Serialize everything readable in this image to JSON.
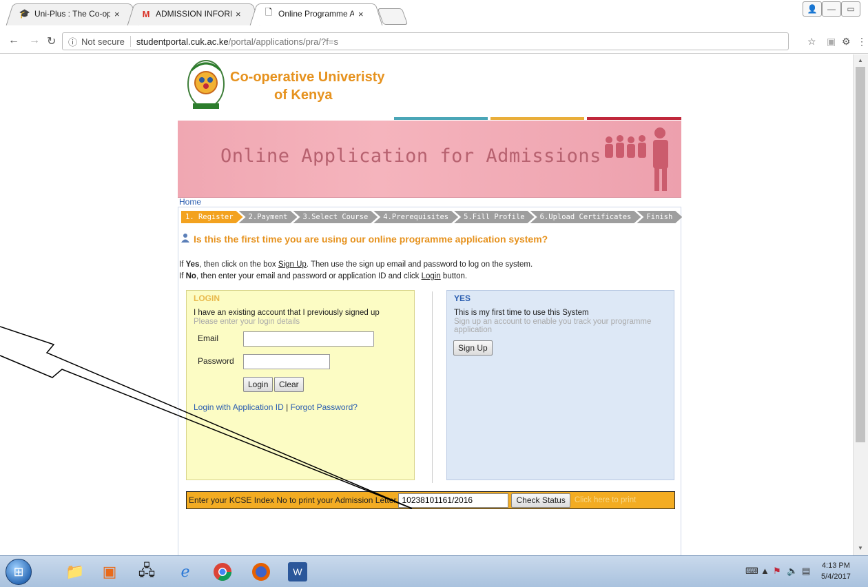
{
  "browser": {
    "tabs": [
      {
        "label": "Uni-Plus : The Co-operat",
        "favicon": "uniplus-icon",
        "active": false
      },
      {
        "label": "ADMISSION INFORMATI",
        "favicon": "gmail-icon",
        "active": false
      },
      {
        "label": "Online Programme Appl",
        "favicon": "page-icon",
        "active": true
      }
    ],
    "tab_close": "×",
    "security_label": "Not secure",
    "url_host": "studentportal.cuk.ac.ke",
    "url_path": "/portal/applications/pra/?f=s"
  },
  "header": {
    "university_line1": "Co-operative Univeristy",
    "university_line2": "of Kenya",
    "banner_title": "Online Application for Admissions",
    "colors": {
      "accent_orange": "#e6921e",
      "teal": "#4aa6b7",
      "gold": "#e9ae3a",
      "crimson": "#c0283b"
    }
  },
  "breadcrumb": {
    "home": "Home"
  },
  "steps": [
    "1. Register",
    "2.Payment",
    "3.Select Course",
    "4.Prerequisites",
    "5.Fill Profile",
    "6.Upload Certificates",
    "Finish"
  ],
  "question": "Is this the first time you are using our online programme application system?",
  "instructions": {
    "yes_prefix": "If ",
    "yes_bold": "Yes",
    "yes_text": ", then click on the box ",
    "yes_link": "Sign Up",
    "yes_suffix": ". Then use the sign up email and password to log on the system.",
    "no_prefix": "If ",
    "no_bold": "No",
    "no_text": ", then enter your email and password or application ID and click ",
    "no_link": "Login",
    "no_suffix": " button."
  },
  "login": {
    "title": "LOGIN",
    "line1": "I have an existing account that I previously signed up",
    "line2": "Please enter your login details",
    "email_label": "Email",
    "email_value": "",
    "password_label": "Password",
    "password_value": "",
    "login_button": "Login",
    "clear_button": "Clear",
    "app_id_link": "Login with Application ID",
    "link_sep": "|",
    "forgot_link": "Forgot Password?"
  },
  "signup": {
    "title": "YES",
    "line1": "This is my first time to use this System",
    "line2": "Sign up an account to enable you track your programme application",
    "button": "Sign Up"
  },
  "kcse": {
    "label": "Enter your KCSE Index No to print your Admission Letter",
    "value": "10238101161/2016",
    "check_button": "Check Status",
    "print_link": "Click here to print"
  },
  "taskbar": {
    "time": "4:13 PM",
    "date": "5/4/2017"
  }
}
